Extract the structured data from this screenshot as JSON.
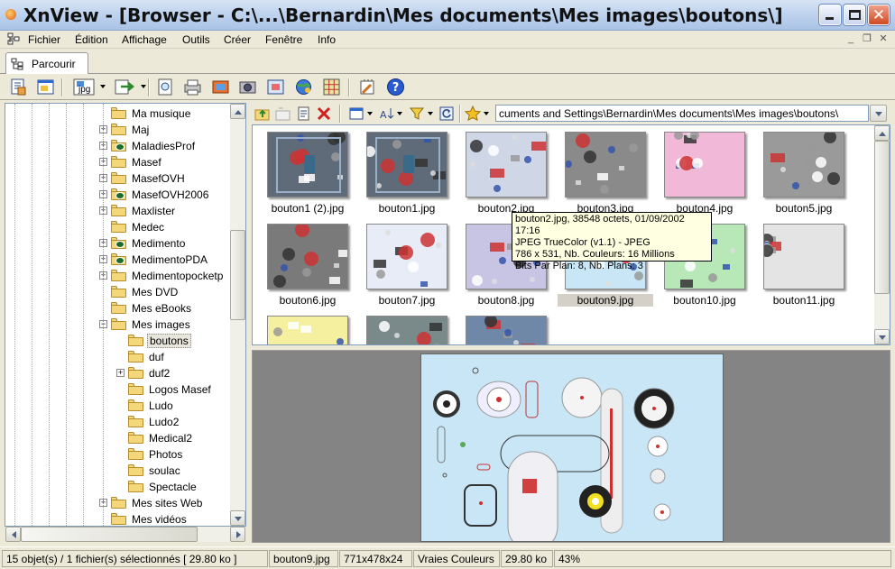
{
  "window": {
    "title": "XnView - [Browser - C:\\...\\Bernardin\\Mes documents\\Mes images\\boutons\\]"
  },
  "menu": [
    "Fichier",
    "Édition",
    "Affichage",
    "Outils",
    "Créer",
    "Fenêtre",
    "Info"
  ],
  "tab": {
    "label": "Parcourir"
  },
  "toolbar": {
    "format_label": "jpg"
  },
  "tree": {
    "items": [
      {
        "label": "Ma musique",
        "level": 0,
        "expand": false,
        "special": false,
        "selected": false
      },
      {
        "label": "Maj",
        "level": 0,
        "expand": true,
        "special": false,
        "selected": false
      },
      {
        "label": "MaladiesProf",
        "level": 0,
        "expand": true,
        "special": true,
        "selected": false
      },
      {
        "label": "Masef",
        "level": 0,
        "expand": true,
        "special": false,
        "selected": false
      },
      {
        "label": "MasefOVH",
        "level": 0,
        "expand": true,
        "special": false,
        "selected": false
      },
      {
        "label": "MasefOVH2006",
        "level": 0,
        "expand": true,
        "special": true,
        "selected": false
      },
      {
        "label": "Maxlister",
        "level": 0,
        "expand": true,
        "special": false,
        "selected": false
      },
      {
        "label": "Medec",
        "level": 0,
        "expand": false,
        "special": false,
        "selected": false
      },
      {
        "label": "Medimento",
        "level": 0,
        "expand": true,
        "special": true,
        "selected": false
      },
      {
        "label": "MedimentoPDA",
        "level": 0,
        "expand": true,
        "special": true,
        "selected": false
      },
      {
        "label": "Medimentopocketp",
        "level": 0,
        "expand": true,
        "special": false,
        "selected": false
      },
      {
        "label": "Mes DVD",
        "level": 0,
        "expand": false,
        "special": false,
        "selected": false
      },
      {
        "label": "Mes eBooks",
        "level": 0,
        "expand": false,
        "special": false,
        "selected": false
      },
      {
        "label": "Mes images",
        "level": 0,
        "expand": "minus",
        "special": false,
        "selected": false
      },
      {
        "label": "boutons",
        "level": 1,
        "expand": false,
        "special": false,
        "selected": true
      },
      {
        "label": "duf",
        "level": 1,
        "expand": false,
        "special": false,
        "selected": false
      },
      {
        "label": "duf2",
        "level": 1,
        "expand": true,
        "special": false,
        "selected": false
      },
      {
        "label": "Logos Masef",
        "level": 1,
        "expand": false,
        "special": false,
        "selected": false
      },
      {
        "label": "Ludo",
        "level": 1,
        "expand": false,
        "special": false,
        "selected": false
      },
      {
        "label": "Ludo2",
        "level": 1,
        "expand": false,
        "special": false,
        "selected": false
      },
      {
        "label": "Medical2",
        "level": 1,
        "expand": false,
        "special": false,
        "selected": false
      },
      {
        "label": "Photos",
        "level": 1,
        "expand": false,
        "special": false,
        "selected": false
      },
      {
        "label": "soulac",
        "level": 1,
        "expand": false,
        "special": false,
        "selected": false
      },
      {
        "label": "Spectacle",
        "level": 1,
        "expand": false,
        "special": false,
        "selected": false
      },
      {
        "label": "Mes sites Web",
        "level": 0,
        "expand": true,
        "special": false,
        "selected": false
      },
      {
        "label": "Mes vidéos",
        "level": 0,
        "expand": false,
        "special": false,
        "selected": false
      }
    ]
  },
  "path": {
    "value": "cuments and Settings\\Bernardin\\Mes documents\\Mes images\\boutons\\"
  },
  "thumbnails": [
    {
      "name": "bouton1 (2).jpg",
      "bg": "#5f6b78",
      "selected": false
    },
    {
      "name": "bouton1.jpg",
      "bg": "#5f6b78",
      "selected": false
    },
    {
      "name": "bouton2.jpg",
      "bg": "#cfd6e6",
      "selected": false
    },
    {
      "name": "bouton3.jpg",
      "bg": "#8a8a8a",
      "selected": false
    },
    {
      "name": "bouton4.jpg",
      "bg": "#f2b8d8",
      "selected": false
    },
    {
      "name": "bouton5.jpg",
      "bg": "#9a9a9a",
      "selected": false
    },
    {
      "name": "bouton6.jpg",
      "bg": "#7a7a7a",
      "selected": false
    },
    {
      "name": "bouton7.jpg",
      "bg": "#e8ecf6",
      "selected": false
    },
    {
      "name": "bouton8.jpg",
      "bg": "#c8c4e4",
      "selected": false
    },
    {
      "name": "bouton9.jpg",
      "bg": "#c8e6f6",
      "selected": true
    },
    {
      "name": "bouton10.jpg",
      "bg": "#b8e8b8",
      "selected": false
    },
    {
      "name": "bouton11.jpg",
      "bg": "#e4e4e4",
      "selected": false
    },
    {
      "name": "",
      "bg": "#f4f0a0",
      "selected": false
    },
    {
      "name": "",
      "bg": "#7a8a8a",
      "selected": false
    },
    {
      "name": "",
      "bg": "#6f88a8",
      "selected": false
    }
  ],
  "tooltip": {
    "lines": [
      "bouton2.jpg, 38548 octets, 01/09/2002 17:16",
      "JPEG TrueColor (v1.1) - JPEG",
      "786 x 531, Nb. Couleurs: 16 Millions",
      "Bits Par Plan: 8, Nb. Plans: 3"
    ]
  },
  "status": {
    "selection": "15 objet(s) / 1 fichier(s) sélectionnés  [ 29.80 ko ]",
    "filename": "bouton9.jpg",
    "dimensions": "771x478x24",
    "colors": "Vraies Couleurs",
    "size": "29.80 ko",
    "zoom": "43%"
  }
}
